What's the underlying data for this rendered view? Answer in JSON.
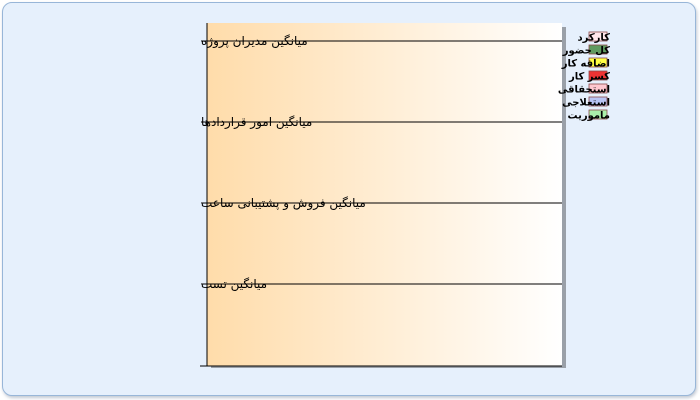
{
  "chart_data": {
    "type": "bar",
    "orientation": "horizontal",
    "categories": [
      "میانگین مدیران پروژه",
      "میانگین امور قراردادها",
      "میانگین فروش و پشتیبانی ساعت",
      "میانگین تست"
    ],
    "series": [
      {
        "name": "کارکرد",
        "color": "#ffe8ec",
        "values": [
          0,
          0,
          0,
          0
        ]
      },
      {
        "name": "کل حضور",
        "color": "#5f9a5f",
        "values": [
          0,
          0,
          0,
          0
        ]
      },
      {
        "name": "اضافه کار",
        "color": "#ffff44",
        "values": [
          0,
          0,
          0,
          0
        ]
      },
      {
        "name": "کسر کار",
        "color": "#ee3333",
        "values": [
          0,
          0,
          0,
          0
        ]
      },
      {
        "name": "استحقاقی",
        "color": "#ffc8d0",
        "values": [
          0,
          0,
          0,
          0
        ]
      },
      {
        "name": "استعلاجی",
        "color": "#b8c4f4",
        "values": [
          0,
          0,
          0,
          0
        ]
      },
      {
        "name": "ماموریت",
        "color": "#aaf0aa",
        "values": [
          0,
          0,
          0,
          0
        ]
      }
    ],
    "legend_position": "top-right",
    "grid": true,
    "plot_background": [
      "#ffdcaa",
      "#ffffff"
    ],
    "page_background": "#e6f0fc"
  }
}
